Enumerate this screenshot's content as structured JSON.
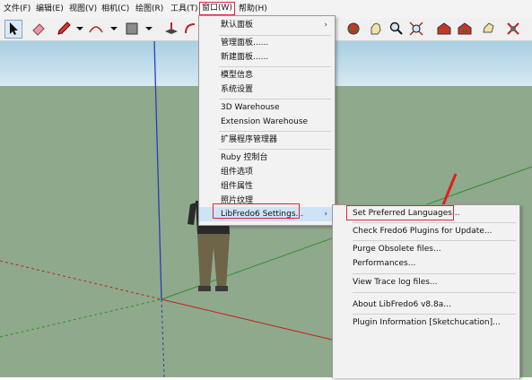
{
  "menubar": {
    "items": [
      "文件(F)",
      "编辑(E)",
      "视图(V)",
      "相机(C)",
      "绘图(R)",
      "工具(T)",
      "窗口(W)",
      "帮助(H)"
    ]
  },
  "window_menu": {
    "items": [
      "默认面板",
      "管理面板......",
      "新建面板......",
      "模型信息",
      "系统设置",
      "3D Warehouse",
      "Extension Warehouse",
      "扩展程序管理器",
      "Ruby 控制台",
      "组件选项",
      "组件属性",
      "照片纹理",
      "LibFredo6 Settings..."
    ]
  },
  "libfredo_submenu": {
    "items": [
      "Set Preferred Languages...",
      "Check Fredo6 Plugins for Update...",
      "Purge Obsolete files...",
      "Performances...",
      "View Trace log files...",
      "About LibFredo6 v8.8a...",
      "Plugin Information [Sketchucation]..."
    ]
  },
  "colors": {
    "sky": "#b9d9ea",
    "ground": "#8fa98c",
    "highlight": "#d9283a",
    "menu_bg": "#f2f2f2"
  },
  "icons": [
    "select-arrow-icon",
    "eraser-icon",
    "pencil-icon",
    "arc-icon",
    "rectangle-icon",
    "push-pull-icon",
    "follow-me-icon",
    "orbit-icon",
    "pan-icon",
    "zoom-icon",
    "zoom-extents-icon",
    "warehouse-icon",
    "share-model-icon",
    "extension-warehouse-icon",
    "component-icon",
    "settings-icon"
  ]
}
